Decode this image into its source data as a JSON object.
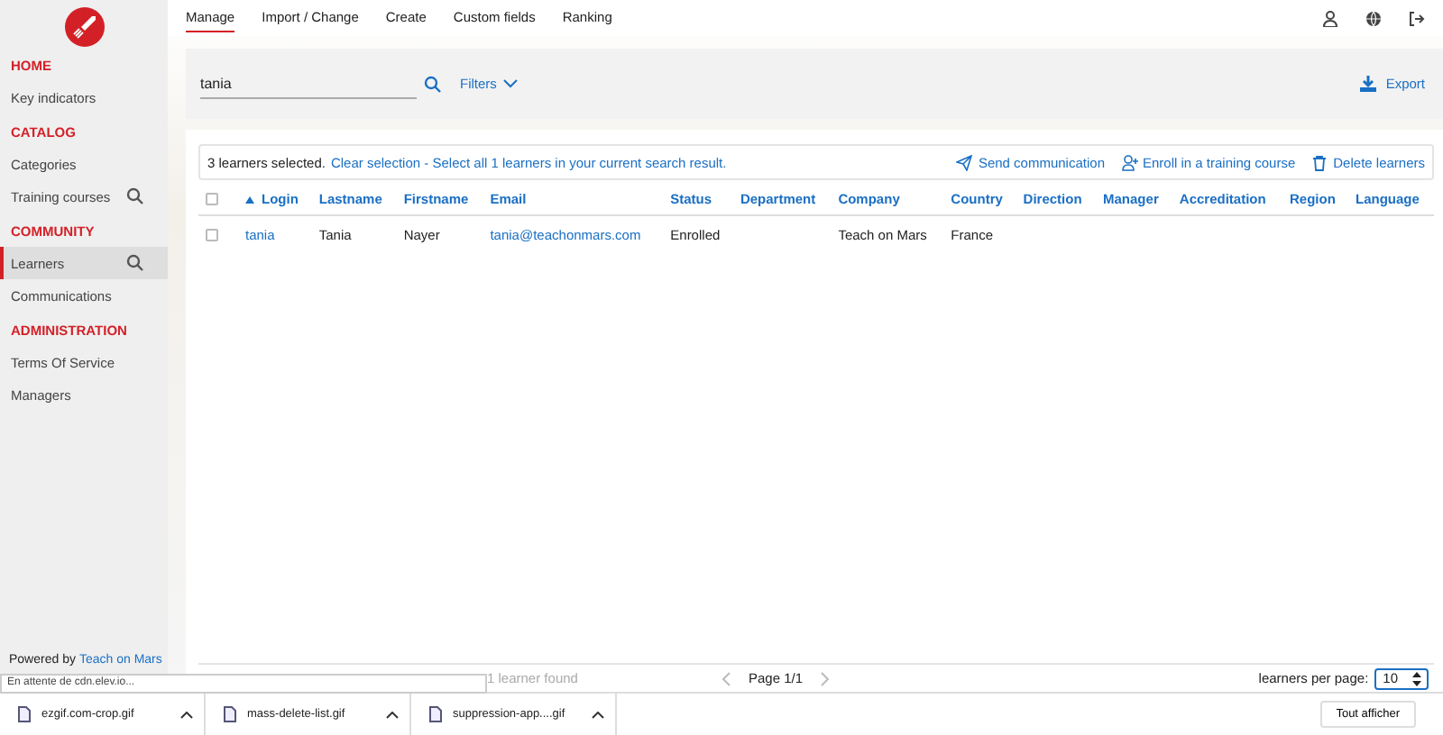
{
  "sidebar": {
    "sections": [
      {
        "title": "HOME",
        "items": [
          {
            "label": "Key indicators",
            "search": false,
            "selected": false
          }
        ]
      },
      {
        "title": "CATALOG",
        "items": [
          {
            "label": "Categories",
            "search": false,
            "selected": false
          },
          {
            "label": "Training courses",
            "search": true,
            "selected": false
          }
        ]
      },
      {
        "title": "COMMUNITY",
        "items": [
          {
            "label": "Learners",
            "search": true,
            "selected": true
          },
          {
            "label": "Communications",
            "search": false,
            "selected": false
          }
        ]
      },
      {
        "title": "ADMINISTRATION",
        "items": [
          {
            "label": "Terms Of Service",
            "search": false,
            "selected": false
          },
          {
            "label": "Managers",
            "search": false,
            "selected": false
          }
        ]
      }
    ],
    "powered_by": "Powered by",
    "powered_link": "Teach on Mars"
  },
  "top_nav": {
    "tabs": [
      {
        "label": "Manage",
        "selected": true
      },
      {
        "label": "Import / Change",
        "selected": false
      },
      {
        "label": "Create",
        "selected": false
      },
      {
        "label": "Custom fields",
        "selected": false
      },
      {
        "label": "Ranking",
        "selected": false
      }
    ]
  },
  "search": {
    "value": "tania",
    "filters": "Filters",
    "export": "Export"
  },
  "selection_bar": {
    "count_text": "3 learners selected.",
    "link": "Clear selection - Select all 1 learners in your current search result.",
    "actions": [
      {
        "kind": "send",
        "label": "Send communication"
      },
      {
        "kind": "enroll",
        "label": "Enroll in a training course"
      },
      {
        "kind": "delete",
        "label": "Delete learners"
      }
    ]
  },
  "table": {
    "all_checked": false,
    "columns": [
      {
        "label": "Login",
        "sorted": true,
        "kind": "link"
      },
      {
        "label": "Lastname",
        "sorted": false,
        "kind": "text"
      },
      {
        "label": "Firstname",
        "sorted": false,
        "kind": "text"
      },
      {
        "label": "Email",
        "sorted": false,
        "kind": "link"
      },
      {
        "label": "Status",
        "sorted": false,
        "kind": "text"
      },
      {
        "label": "Department",
        "sorted": false
      },
      {
        "label": "Company",
        "sorted": false,
        "kind": "text"
      },
      {
        "label": "Country",
        "sorted": false,
        "kind": "text"
      },
      {
        "label": "Direction",
        "sorted": false
      },
      {
        "label": "Manager",
        "sorted": false
      },
      {
        "label": "Accreditation",
        "sorted": false
      },
      {
        "label": "Region",
        "sorted": false
      },
      {
        "label": "Language",
        "sorted": false
      }
    ],
    "rows": [
      {
        "checked": false,
        "cells": [
          "tania",
          "Tania",
          "Nayer",
          "tania@teachonmars.com",
          "Enrolled",
          "",
          "Teach on Mars",
          "France",
          "",
          "",
          "",
          "",
          ""
        ]
      }
    ]
  },
  "footer": {
    "count": "1 learner found",
    "page": "Page 1/1",
    "per_page_label": "learners per page:",
    "per_page": "10"
  },
  "status_bubble": "En attente de cdn.elev.io...",
  "downloads": {
    "files": [
      {
        "name": "ezgif.com-crop.gif"
      },
      {
        "name": "mass-delete-list.gif"
      },
      {
        "name": "suppression-app....gif"
      }
    ],
    "show_all": "Tout afficher"
  }
}
